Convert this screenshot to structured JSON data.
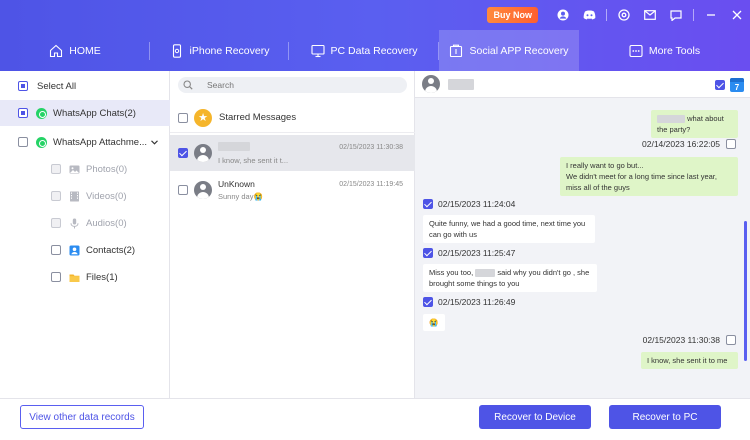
{
  "header": {
    "buy_now": "Buy Now",
    "tabs": [
      {
        "label": "HOME",
        "icon": "home-icon"
      },
      {
        "label": "iPhone Recovery",
        "icon": "phone-icon"
      },
      {
        "label": "PC Data Recovery",
        "icon": "pc-icon"
      },
      {
        "label": "Social APP Recovery",
        "icon": "social-app-icon",
        "active": true
      },
      {
        "label": "More Tools",
        "icon": "more-tools-icon"
      }
    ]
  },
  "sidebar": {
    "select_all": "Select All",
    "items": [
      {
        "label": "WhatsApp Chats(2)"
      },
      {
        "label": "WhatsApp Attachme..."
      },
      {
        "label": "Photos(0)"
      },
      {
        "label": "Videos(0)"
      },
      {
        "label": "Audios(0)"
      },
      {
        "label": "Contacts(2)"
      },
      {
        "label": "Files(1)"
      }
    ]
  },
  "middle": {
    "search_placeholder": "Search",
    "starred_label": "Starred Messages",
    "chats": [
      {
        "name": "",
        "preview": "I know, she sent it t...",
        "time": "02/15/2023 11:30:38"
      },
      {
        "name": "UnKnown",
        "preview": "Sunny day😭",
        "time": "02/15/2023 11:19:45"
      }
    ]
  },
  "conversation": {
    "calendar_day": "7",
    "messages": [
      {
        "dir": "out",
        "text": "what about the party?"
      },
      {
        "ts": "02/14/2023 16:22:05"
      },
      {
        "dir": "out",
        "text": "I really want to go but...\nWe didn't meet for a long time since last year, miss all of the guys"
      },
      {
        "ts": "02/15/2023 11:24:04"
      },
      {
        "dir": "in",
        "text": "Quite funny, we had a good time, next time you can go with us"
      },
      {
        "ts": "02/15/2023 11:25:47"
      },
      {
        "dir": "in",
        "text_a": "Miss you too,",
        "text_b": "said why you didn't go , she brought some things to you"
      },
      {
        "ts": "02/15/2023 11:26:49"
      },
      {
        "dir": "in",
        "text": "😭"
      },
      {
        "ts": "02/15/2023 11:30:38"
      },
      {
        "dir": "out",
        "text": "I know, she sent it to me"
      }
    ]
  },
  "footer": {
    "view_other": "View other data records",
    "recover_device": "Recover to Device",
    "recover_pc": "Recover to PC"
  },
  "colors": {
    "accent": "#4e54e6",
    "whatsapp": "#25d366",
    "bubble_out": "#dff5c8"
  }
}
